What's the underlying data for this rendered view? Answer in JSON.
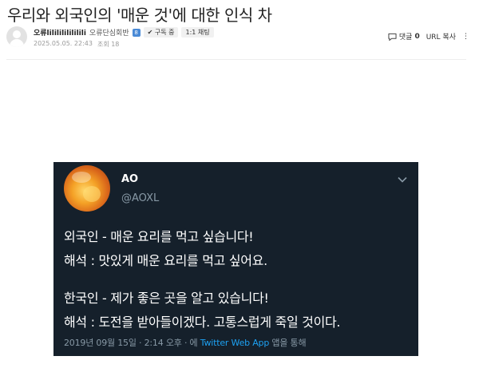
{
  "post": {
    "title": "우리와 외국인의 '매운 것'에 대한 인식 차",
    "author": "오류lililililililili",
    "group": "오류단심회반",
    "level_badge": "8",
    "subscribe_label": "✔ 구독 중",
    "chat_label": "1:1 채팅",
    "date": "2025.05.05. 22:43",
    "views": "조회 18",
    "comment_label": "댓글",
    "comment_count": "0",
    "url_copy_label": "URL 복사",
    "more_label": "⋮"
  },
  "tweet": {
    "name": "AO",
    "handle": "@AOXL",
    "lines": [
      "외국인 - 매운 요리를 먹고 싶습니다!",
      "해석 : 맛있게 매운 요리를 먹고 싶어요.",
      "한국인 - 제가 좋은 곳을 알고 있습니다!",
      "해석 : 도전을 받아들이겠다. 고통스럽게 죽일 것이다."
    ],
    "footer_time": "2019년 09월 15일 · 2:14 오후 · 에",
    "footer_app": "Twitter Web App",
    "footer_suffix": "앱을 통해"
  },
  "icons": [
    "user-avatar-icon",
    "comment-icon",
    "chevron-down-icon"
  ],
  "colors": {
    "tweet_bg": "#15202b",
    "tweet_link": "#1da1f2",
    "tweet_muted": "#8899a6",
    "level_badge": "#4a8ad6"
  }
}
